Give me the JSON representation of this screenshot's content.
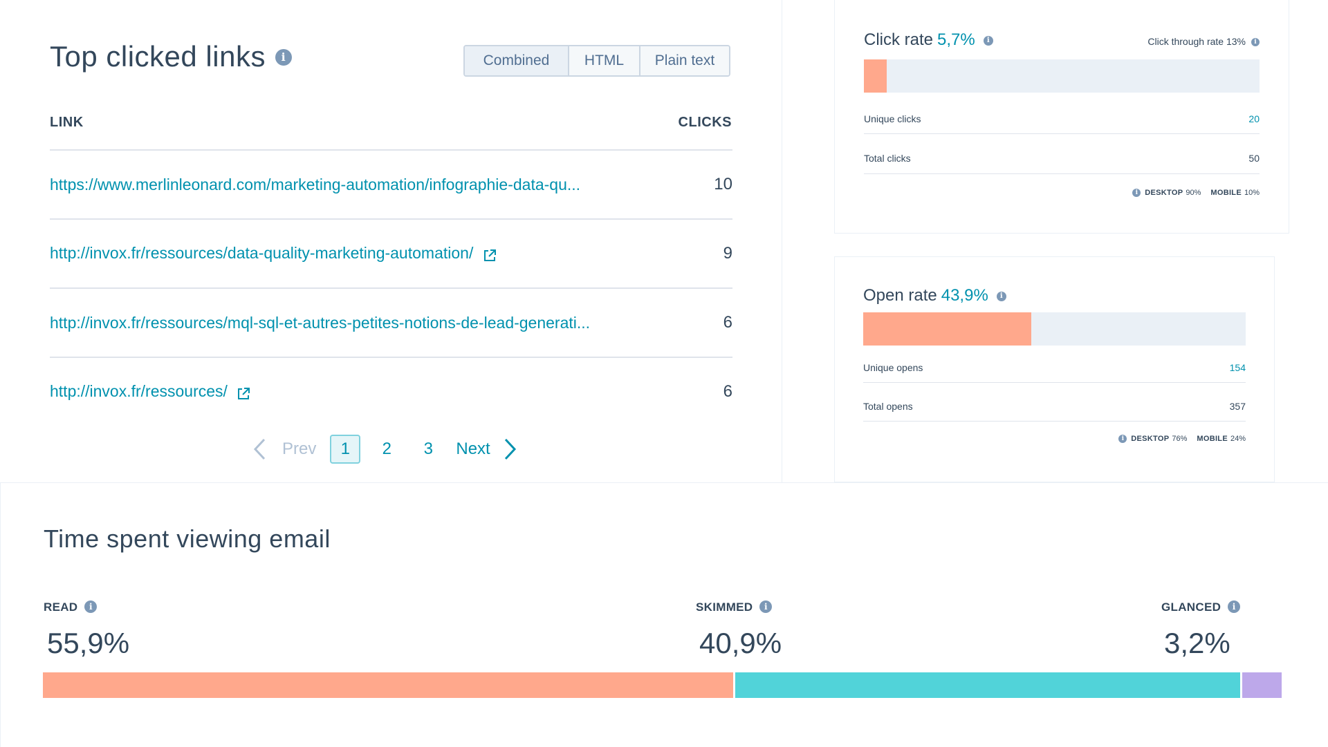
{
  "top_links": {
    "title": "Top clicked links",
    "filters": [
      "Combined",
      "HTML",
      "Plain text"
    ],
    "active_filter": "Combined",
    "col_link": "LINK",
    "col_clicks": "CLICKS",
    "rows": [
      {
        "url": "https://www.merlinleonard.com/marketing-automation/infographie-data-qu...",
        "clicks": "10",
        "external": false
      },
      {
        "url": "http://invox.fr/ressources/data-quality-marketing-automation/",
        "clicks": "9",
        "external": true
      },
      {
        "url": "http://invox.fr/ressources/mql-sql-et-autres-petites-notions-de-lead-generati...",
        "clicks": "6",
        "external": false
      },
      {
        "url": "http://invox.fr/ressources/",
        "clicks": "6",
        "external": true
      }
    ],
    "pager": {
      "prev": "Prev",
      "pages": [
        "1",
        "2",
        "3"
      ],
      "current": "1",
      "next": "Next"
    }
  },
  "click_rate": {
    "label": "Click rate",
    "value": "5,7%",
    "fill_fraction": 0.057,
    "ctr_label": "Click through rate 13%",
    "unique_label": "Unique clicks",
    "unique_value": "20",
    "total_label": "Total clicks",
    "total_value": "50",
    "desktop_label": "DESKTOP",
    "desktop_value": "90%",
    "mobile_label": "MOBILE",
    "mobile_value": "10%"
  },
  "open_rate": {
    "label": "Open rate",
    "value": "43,9%",
    "fill_fraction": 0.439,
    "unique_label": "Unique opens",
    "unique_value": "154",
    "total_label": "Total opens",
    "total_value": "357",
    "desktop_label": "DESKTOP",
    "desktop_value": "76%",
    "mobile_label": "MOBILE",
    "mobile_value": "24%"
  },
  "time_spent": {
    "title": "Time spent viewing email",
    "segments": [
      {
        "label": "READ",
        "value": "55,9%",
        "fraction": 0.559,
        "color": "#ffa88c"
      },
      {
        "label": "SKIMMED",
        "value": "40,9%",
        "fraction": 0.409,
        "color": "#51d3d9"
      },
      {
        "label": "GLANCED",
        "value": "3,2%",
        "fraction": 0.032,
        "color": "#bda8ea"
      }
    ]
  },
  "colors": {
    "accent": "#0091ae",
    "text": "#33475b",
    "info_icon": "#7c98b6"
  },
  "icons": {
    "info": "info-icon",
    "external": "external-link-icon",
    "prev": "chevron-left-icon",
    "next": "chevron-right-icon"
  }
}
